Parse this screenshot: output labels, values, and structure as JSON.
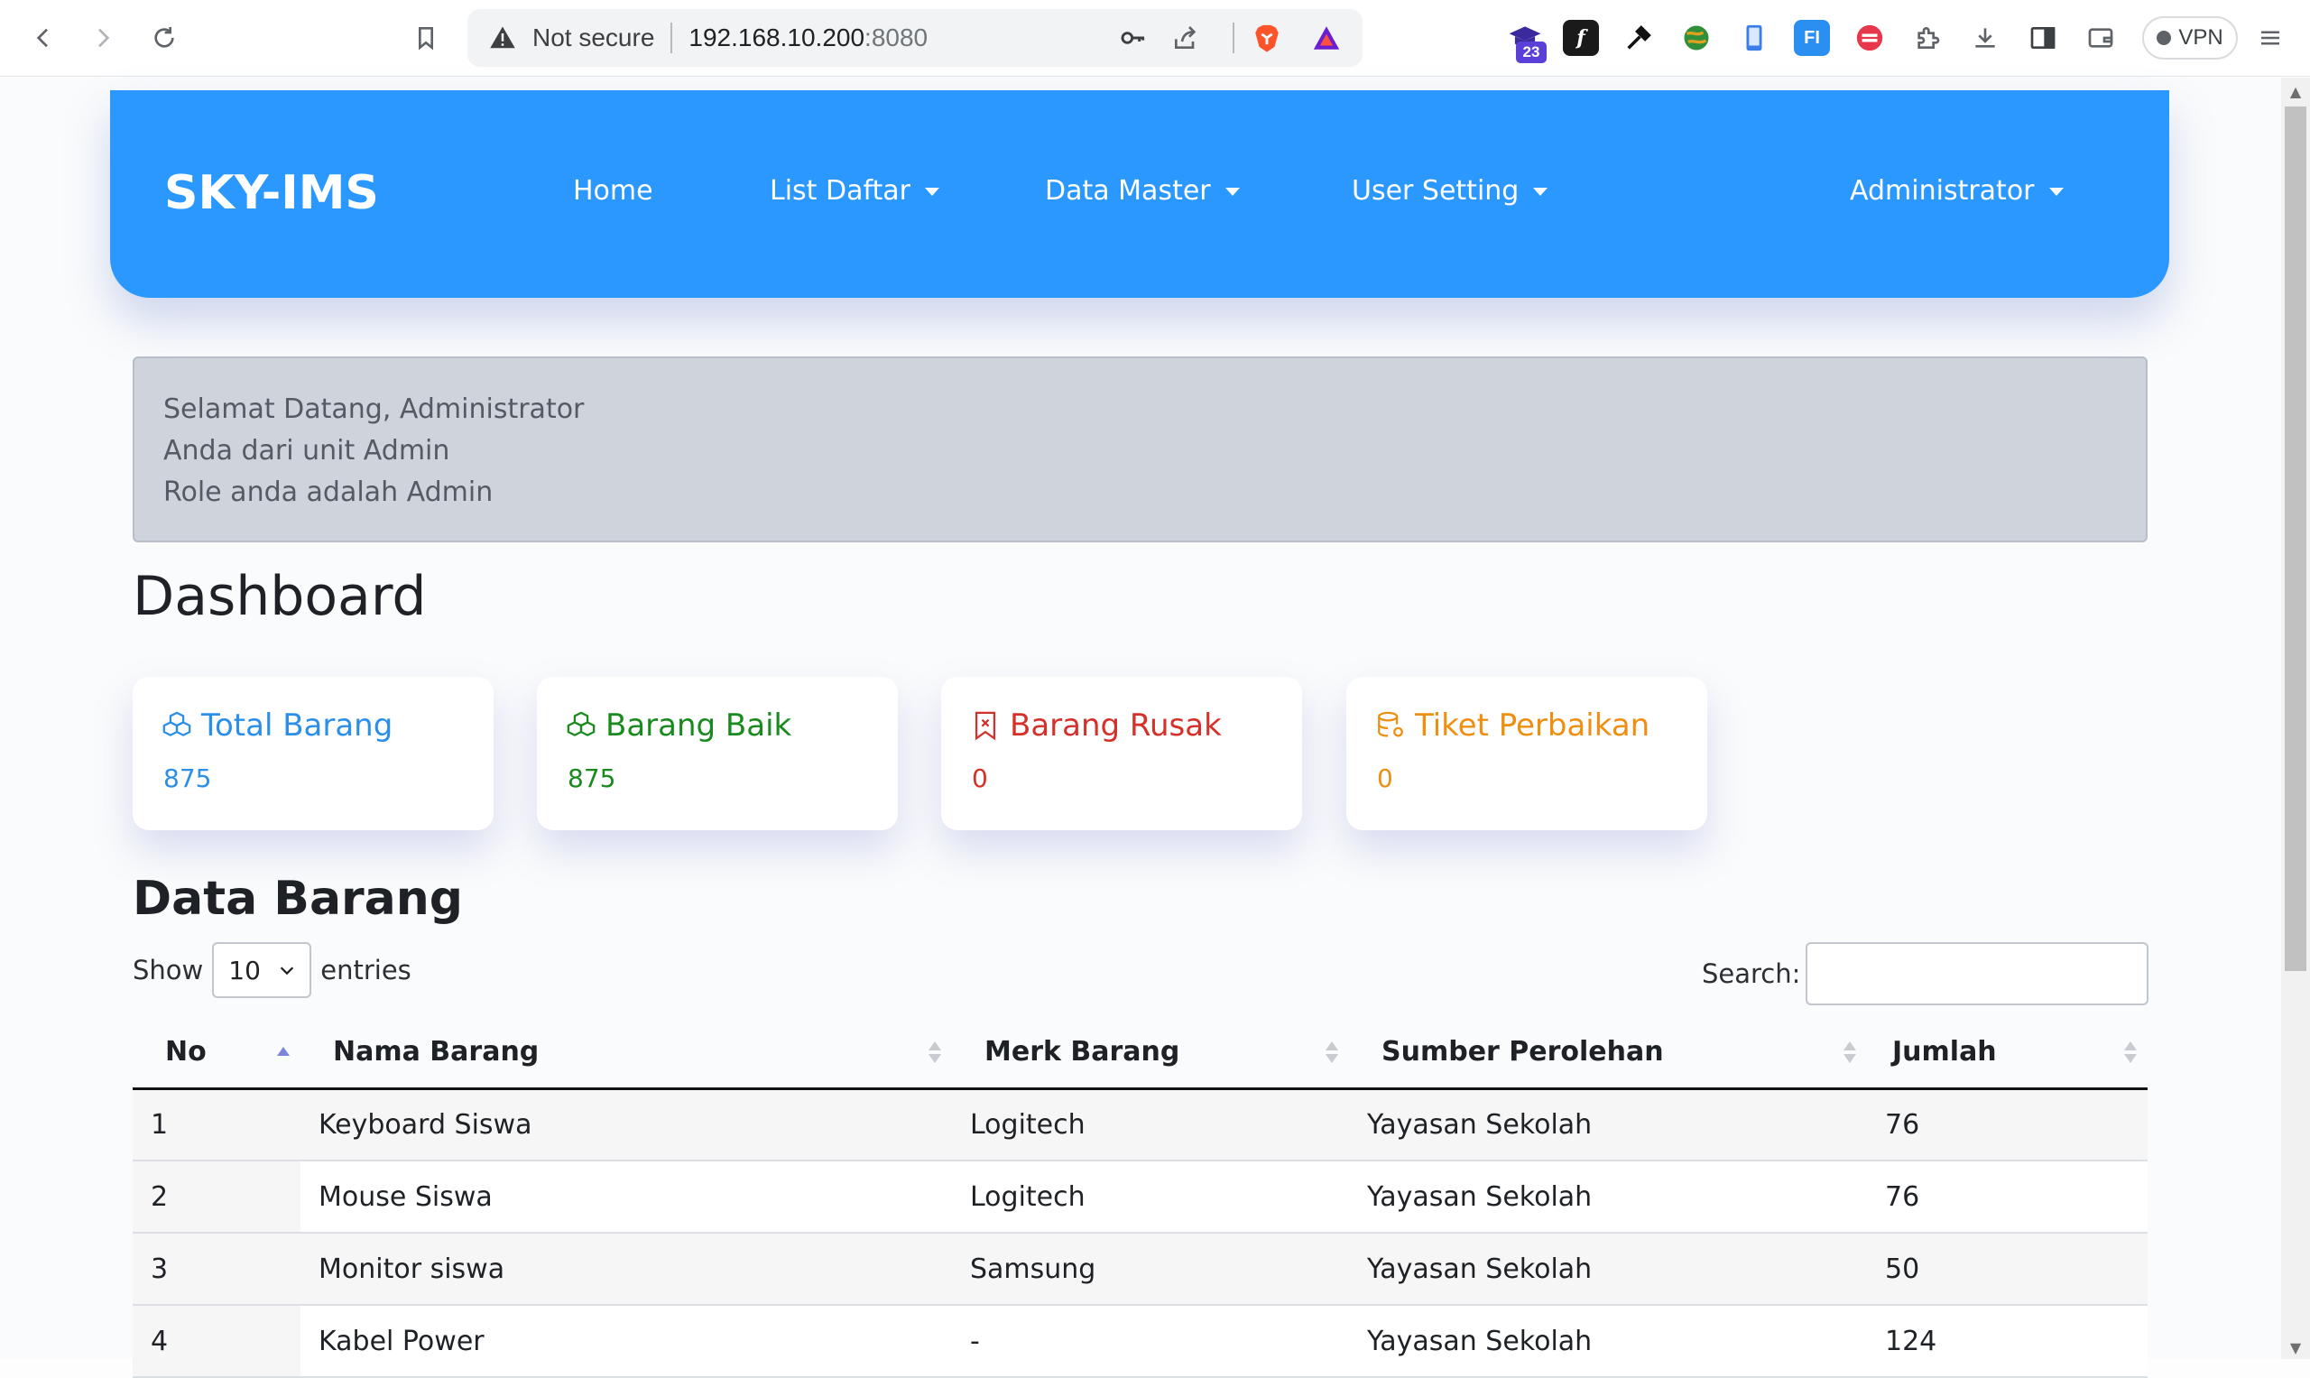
{
  "browser": {
    "security_label": "Not secure",
    "url_host": "192.168.10.200",
    "url_port": ":8080",
    "extension_badge": "23",
    "vpn_label": "VPN"
  },
  "navbar": {
    "brand": "SKY-IMS",
    "items": [
      {
        "label": "Home",
        "dropdown": false
      },
      {
        "label": "List Daftar",
        "dropdown": true
      },
      {
        "label": "Data Master",
        "dropdown": true
      },
      {
        "label": "User Setting",
        "dropdown": true
      }
    ],
    "user_menu": "Administrator"
  },
  "welcome": {
    "line1": "Selamat Datang, Administrator",
    "line2": "Anda dari unit Admin",
    "line3": "Role anda adalah Admin"
  },
  "dashboard": {
    "title": "Dashboard",
    "cards": [
      {
        "title": "Total Barang",
        "value": "875",
        "color": "#2b8ee8",
        "icon": "boxes-icon"
      },
      {
        "title": "Barang Baik",
        "value": "875",
        "color": "#198a1e",
        "icon": "boxes-icon"
      },
      {
        "title": "Barang Rusak",
        "value": "0",
        "color": "#d6302a",
        "icon": "bookmark-x-icon"
      },
      {
        "title": "Tiket Perbaikan",
        "value": "0",
        "color": "#ef8f12",
        "icon": "database-gear-icon"
      }
    ]
  },
  "data_barang": {
    "title": "Data Barang",
    "show_label": "Show",
    "page_length": "10",
    "entries_label": "entries",
    "search_label": "Search:",
    "search_value": "",
    "columns": [
      "No",
      "Nama Barang",
      "Merk Barang",
      "Sumber Perolehan",
      "Jumlah"
    ],
    "rows": [
      [
        "1",
        "Keyboard Siswa",
        "Logitech",
        "Yayasan Sekolah",
        "76"
      ],
      [
        "2",
        "Mouse Siswa",
        "Logitech",
        "Yayasan Sekolah",
        "76"
      ],
      [
        "3",
        "Monitor siswa",
        "Samsung",
        "Yayasan Sekolah",
        "50"
      ],
      [
        "4",
        "Kabel Power",
        "-",
        "Yayasan Sekolah",
        "124"
      ]
    ]
  }
}
